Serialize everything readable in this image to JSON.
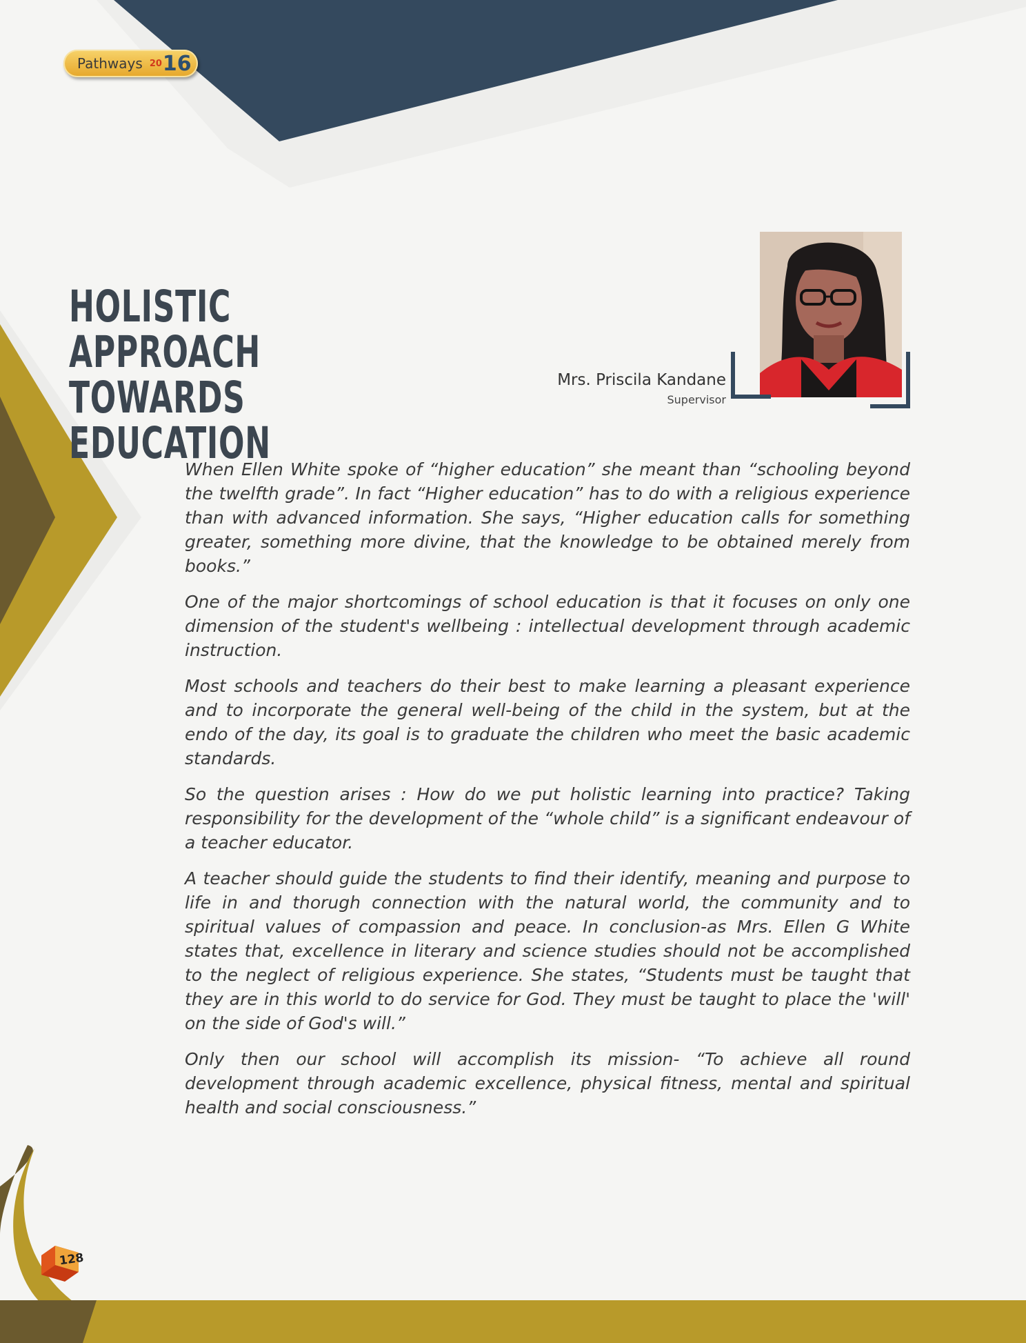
{
  "header_badge": {
    "word": "Pathways",
    "year_small": "20",
    "year_large": "16"
  },
  "article": {
    "title_line1": "HOLISTIC APPROACH TOWARDS",
    "title_line2": "EDUCATION",
    "author_name": "Mrs. Priscila Kandane",
    "author_role": "Supervisor",
    "paragraphs": [
      "When Ellen White spoke of “higher education” she meant than “schooling beyond the twelfth grade”. In fact “Higher education” has to do with a religious experience than with advanced information. She says, “Higher education calls for something greater, something more divine, that the knowledge to be obtained merely from books.”",
      "One of the major shortcomings of school education is that it focuses on only one dimension of the student's wellbeing : intellectual development through academic instruction.",
      "Most schools and teachers do their best to make learning a pleasant experience and to incorporate the general well-being of the child in the system, but at the endo of the day, its goal is to graduate the children who meet the basic academic standards.",
      "So the question arises : How do we put holistic learning into practice? Taking responsibility for the development of the “whole child” is a significant endeavour of a teacher educator.",
      "A teacher should guide the students to find their identify, meaning and purpose to life in and thorugh connection with the natural world, the community and to spiritual values of compassion and peace. In conclusion-as Mrs. Ellen G White states that, excellence in literary and science studies should not be accomplished to the neglect of religious experience. She states, “Students must be taught that they are in this world to do service for God. They must be taught to place the 'will' on the side of God's will.”",
      "Only then our school will accomplish its mission- “To achieve all round development through academic excellence, physical fitness, mental and spiritual health and social consciousness.”"
    ]
  },
  "page_number": "128",
  "colors": {
    "navy": "#34495e",
    "gold": "#b89a2a",
    "brown": "#6b5a2e",
    "text": "#3a3a3a"
  }
}
